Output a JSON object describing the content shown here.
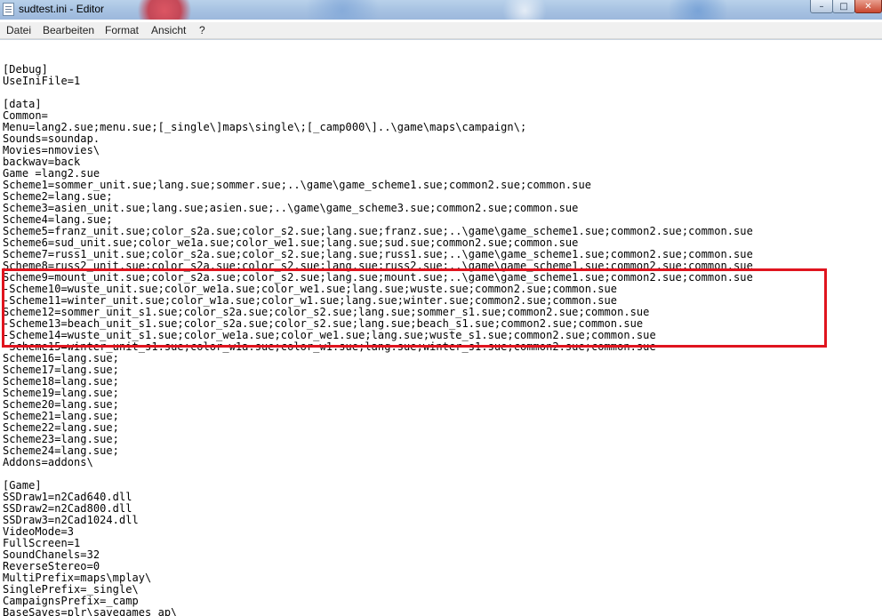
{
  "window": {
    "title": "sudtest.ini - Editor",
    "app_icon": "notepad-icon",
    "controls": {
      "minimize": "–",
      "maximize": "□",
      "close": "✕"
    }
  },
  "menu": [
    "Datei",
    "Bearbeiten",
    "Format",
    "Ansicht",
    "?"
  ],
  "editor": {
    "lines": [
      "",
      "[Debug]",
      "UseIniFile=1",
      "",
      "[data]",
      "Common=",
      "Menu=lang2.sue;menu.sue;[_single\\]maps\\single\\;[_camp000\\]..\\game\\maps\\campaign\\;",
      "Sounds=soundap.",
      "Movies=nmovies\\",
      "backwav=back",
      "Game =lang2.sue",
      "Scheme1=sommer_unit.sue;lang.sue;sommer.sue;..\\game\\game_scheme1.sue;common2.sue;common.sue",
      "Scheme2=lang.sue;",
      "Scheme3=asien_unit.sue;lang.sue;asien.sue;..\\game\\game_scheme3.sue;common2.sue;common.sue",
      "Scheme4=lang.sue;",
      "Scheme5=franz_unit.sue;color_s2a.sue;color_s2.sue;lang.sue;franz.sue;..\\game\\game_scheme1.sue;common2.sue;common.sue",
      "Scheme6=sud_unit.sue;color_we1a.sue;color_we1.sue;lang.sue;sud.sue;common2.sue;common.sue",
      "Scheme7=russ1_unit.sue;color_s2a.sue;color_s2.sue;lang.sue;russ1.sue;..\\game\\game_scheme1.sue;common2.sue;common.sue",
      "Scheme8=russ2_unit.sue;color_s2a.sue;color_s2.sue;lang.sue;russ2.sue;..\\game\\game_scheme1.sue;common2.sue;common.sue",
      "Scheme9=mount_unit.sue;color_s2a.sue;color_s2.sue;lang.sue;mount.sue;..\\game\\game_scheme1.sue;common2.sue;common.sue",
      "-Scheme10=wuste_unit.sue;color_we1a.sue;color_we1.sue;lang.sue;wuste.sue;common2.sue;common.sue",
      "-Scheme11=winter_unit.sue;color_w1a.sue;color_w1.sue;lang.sue;winter.sue;common2.sue;common.sue",
      "Scheme12=sommer_unit_s1.sue;color_s2a.sue;color_s2.sue;lang.sue;sommer_s1.sue;common2.sue;common.sue",
      "-Scheme13=beach_unit_s1.sue;color_s2a.sue;color_s2.sue;lang.sue;beach_s1.sue;common2.sue;common.sue",
      "-Scheme14=wuste_unit_s1.sue;color_we1a.sue;color_we1.sue;lang.sue;wuste_s1.sue;common2.sue;common.sue",
      "-Scheme15=winter_unit_s1.sue;color_w1a.sue;color_w1.sue;lang.sue;winter_s1.sue;common2.sue;common.sue",
      "Scheme16=lang.sue;",
      "Scheme17=lang.sue;",
      "Scheme18=lang.sue;",
      "Scheme19=lang.sue;",
      "Scheme20=lang.sue;",
      "Scheme21=lang.sue;",
      "Scheme22=lang.sue;",
      "Scheme23=lang.sue;",
      "Scheme24=lang.sue;",
      "Addons=addons\\",
      "",
      "[Game]",
      "SSDraw1=n2Cad640.dll",
      "SSDraw2=n2Cad800.dll",
      "SSDraw3=n2Cad1024.dll",
      "VideoMode=3",
      "FullScreen=1",
      "SoundChanels=32",
      "ReverseStereo=0",
      "MultiPrefix=maps\\mplay\\",
      "SinglePrefix=_single\\",
      "CampaignsPrefix=_camp",
      "BaseSaves=plr\\savegames_ap\\"
    ],
    "highlight_color": "#e0141e"
  }
}
